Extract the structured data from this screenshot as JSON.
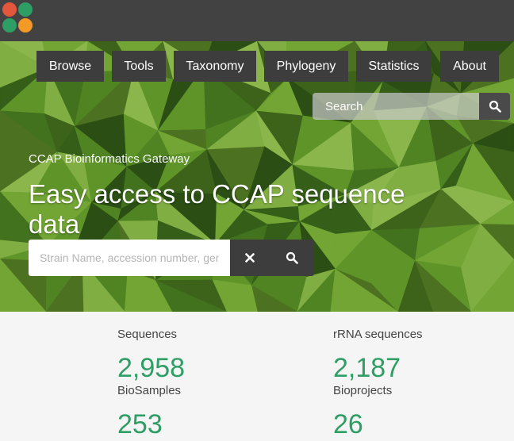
{
  "colors": {
    "topbar": "#424242",
    "nav_bg": "#3d3d3d",
    "accent": "#2e9e64",
    "hero_green": "#4d8a22"
  },
  "logo": {
    "icon": "ccap-logo-icon",
    "colors": [
      "#e4573d",
      "#2e9e64",
      "#2e9e64",
      "#f39a26"
    ]
  },
  "nav": {
    "items": [
      "Browse",
      "Tools",
      "Taxonomy",
      "Phylogeny",
      "Statistics",
      "About"
    ]
  },
  "top_search": {
    "placeholder": "Search",
    "icon": "search-icon"
  },
  "hero": {
    "subtitle": "CCAP Bioinformatics Gateway",
    "title": "Easy access to CCAP sequence data",
    "search_placeholder": "Strain Name, accession number, gene...",
    "clear_icon": "close-icon",
    "search_icon": "search-icon"
  },
  "stats": [
    {
      "label": "Sequences",
      "value": "2,958"
    },
    {
      "label": "rRNA sequences",
      "value": "2,187"
    },
    {
      "label": "BioSamples",
      "value": "253"
    },
    {
      "label": "Bioprojects",
      "value": "26"
    }
  ]
}
